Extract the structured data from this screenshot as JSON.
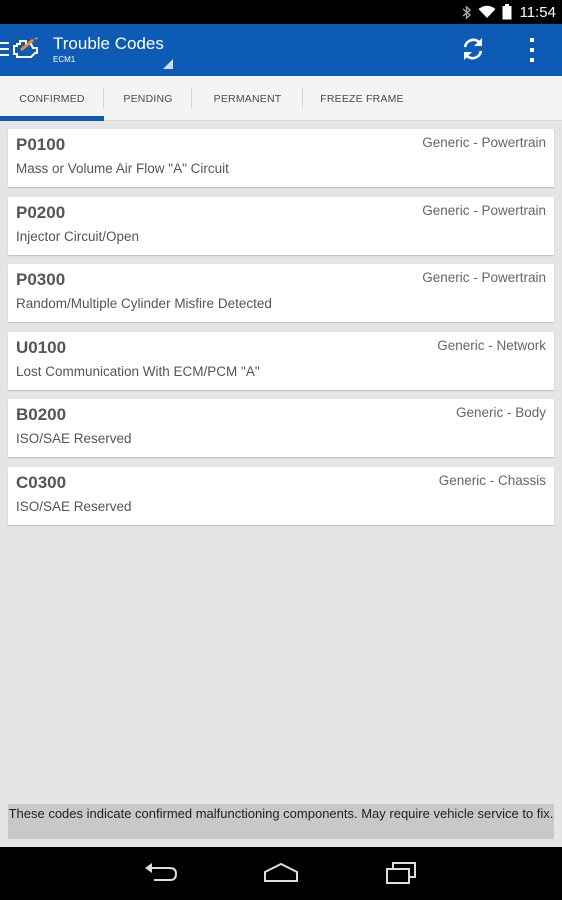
{
  "status_bar": {
    "time": "11:54"
  },
  "action_bar": {
    "title": "Trouble Codes",
    "subtitle": "ECM1",
    "icons": {
      "nav": "menu-icon",
      "app": "check-engine-icon",
      "refresh": "refresh-icon",
      "overflow": "more-vert-icon"
    }
  },
  "tabs": [
    {
      "label": "CONFIRMED",
      "active": true
    },
    {
      "label": "PENDING",
      "active": false
    },
    {
      "label": "PERMANENT",
      "active": false
    },
    {
      "label": "FREEZE FRAME",
      "active": false
    }
  ],
  "codes": [
    {
      "code": "P0100",
      "category": "Generic - Powertrain",
      "description": "Mass or Volume Air Flow \"A\" Circuit"
    },
    {
      "code": "P0200",
      "category": "Generic - Powertrain",
      "description": "Injector Circuit/Open"
    },
    {
      "code": "P0300",
      "category": "Generic - Powertrain",
      "description": "Random/Multiple Cylinder Misfire Detected"
    },
    {
      "code": "U0100",
      "category": "Generic - Network",
      "description": "Lost Communication With ECM/PCM \"A\""
    },
    {
      "code": "B0200",
      "category": "Generic - Body",
      "description": "ISO/SAE Reserved"
    },
    {
      "code": "C0300",
      "category": "Generic - Chassis",
      "description": "ISO/SAE Reserved"
    }
  ],
  "footer_note": "These codes indicate confirmed malfunctioning components. May require vehicle service to fix.",
  "colors": {
    "primary": "#0d5bb5",
    "background": "#e5e5e5",
    "card": "#ffffff"
  }
}
